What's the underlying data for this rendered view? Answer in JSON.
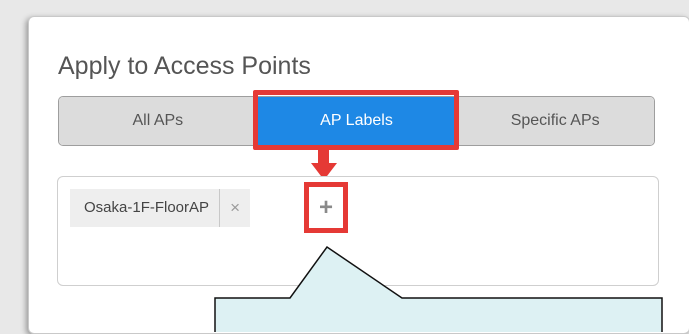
{
  "panel": {
    "title": "Apply to Access Points"
  },
  "tabs": [
    {
      "label": "All APs",
      "active": false
    },
    {
      "label": "AP Labels",
      "active": true
    },
    {
      "label": "Specific APs",
      "active": false
    }
  ],
  "labels": {
    "tags": [
      {
        "text": "Osaka-1F-FloorAP",
        "remove_icon": "×"
      }
    ],
    "add_icon": "+"
  },
  "colors": {
    "accent_blue": "#1e88e5",
    "highlight_red": "#e53935",
    "callout_fill": "#ddf1f3"
  },
  "icons": [
    "close-icon",
    "plus-icon",
    "arrow-down-icon"
  ]
}
